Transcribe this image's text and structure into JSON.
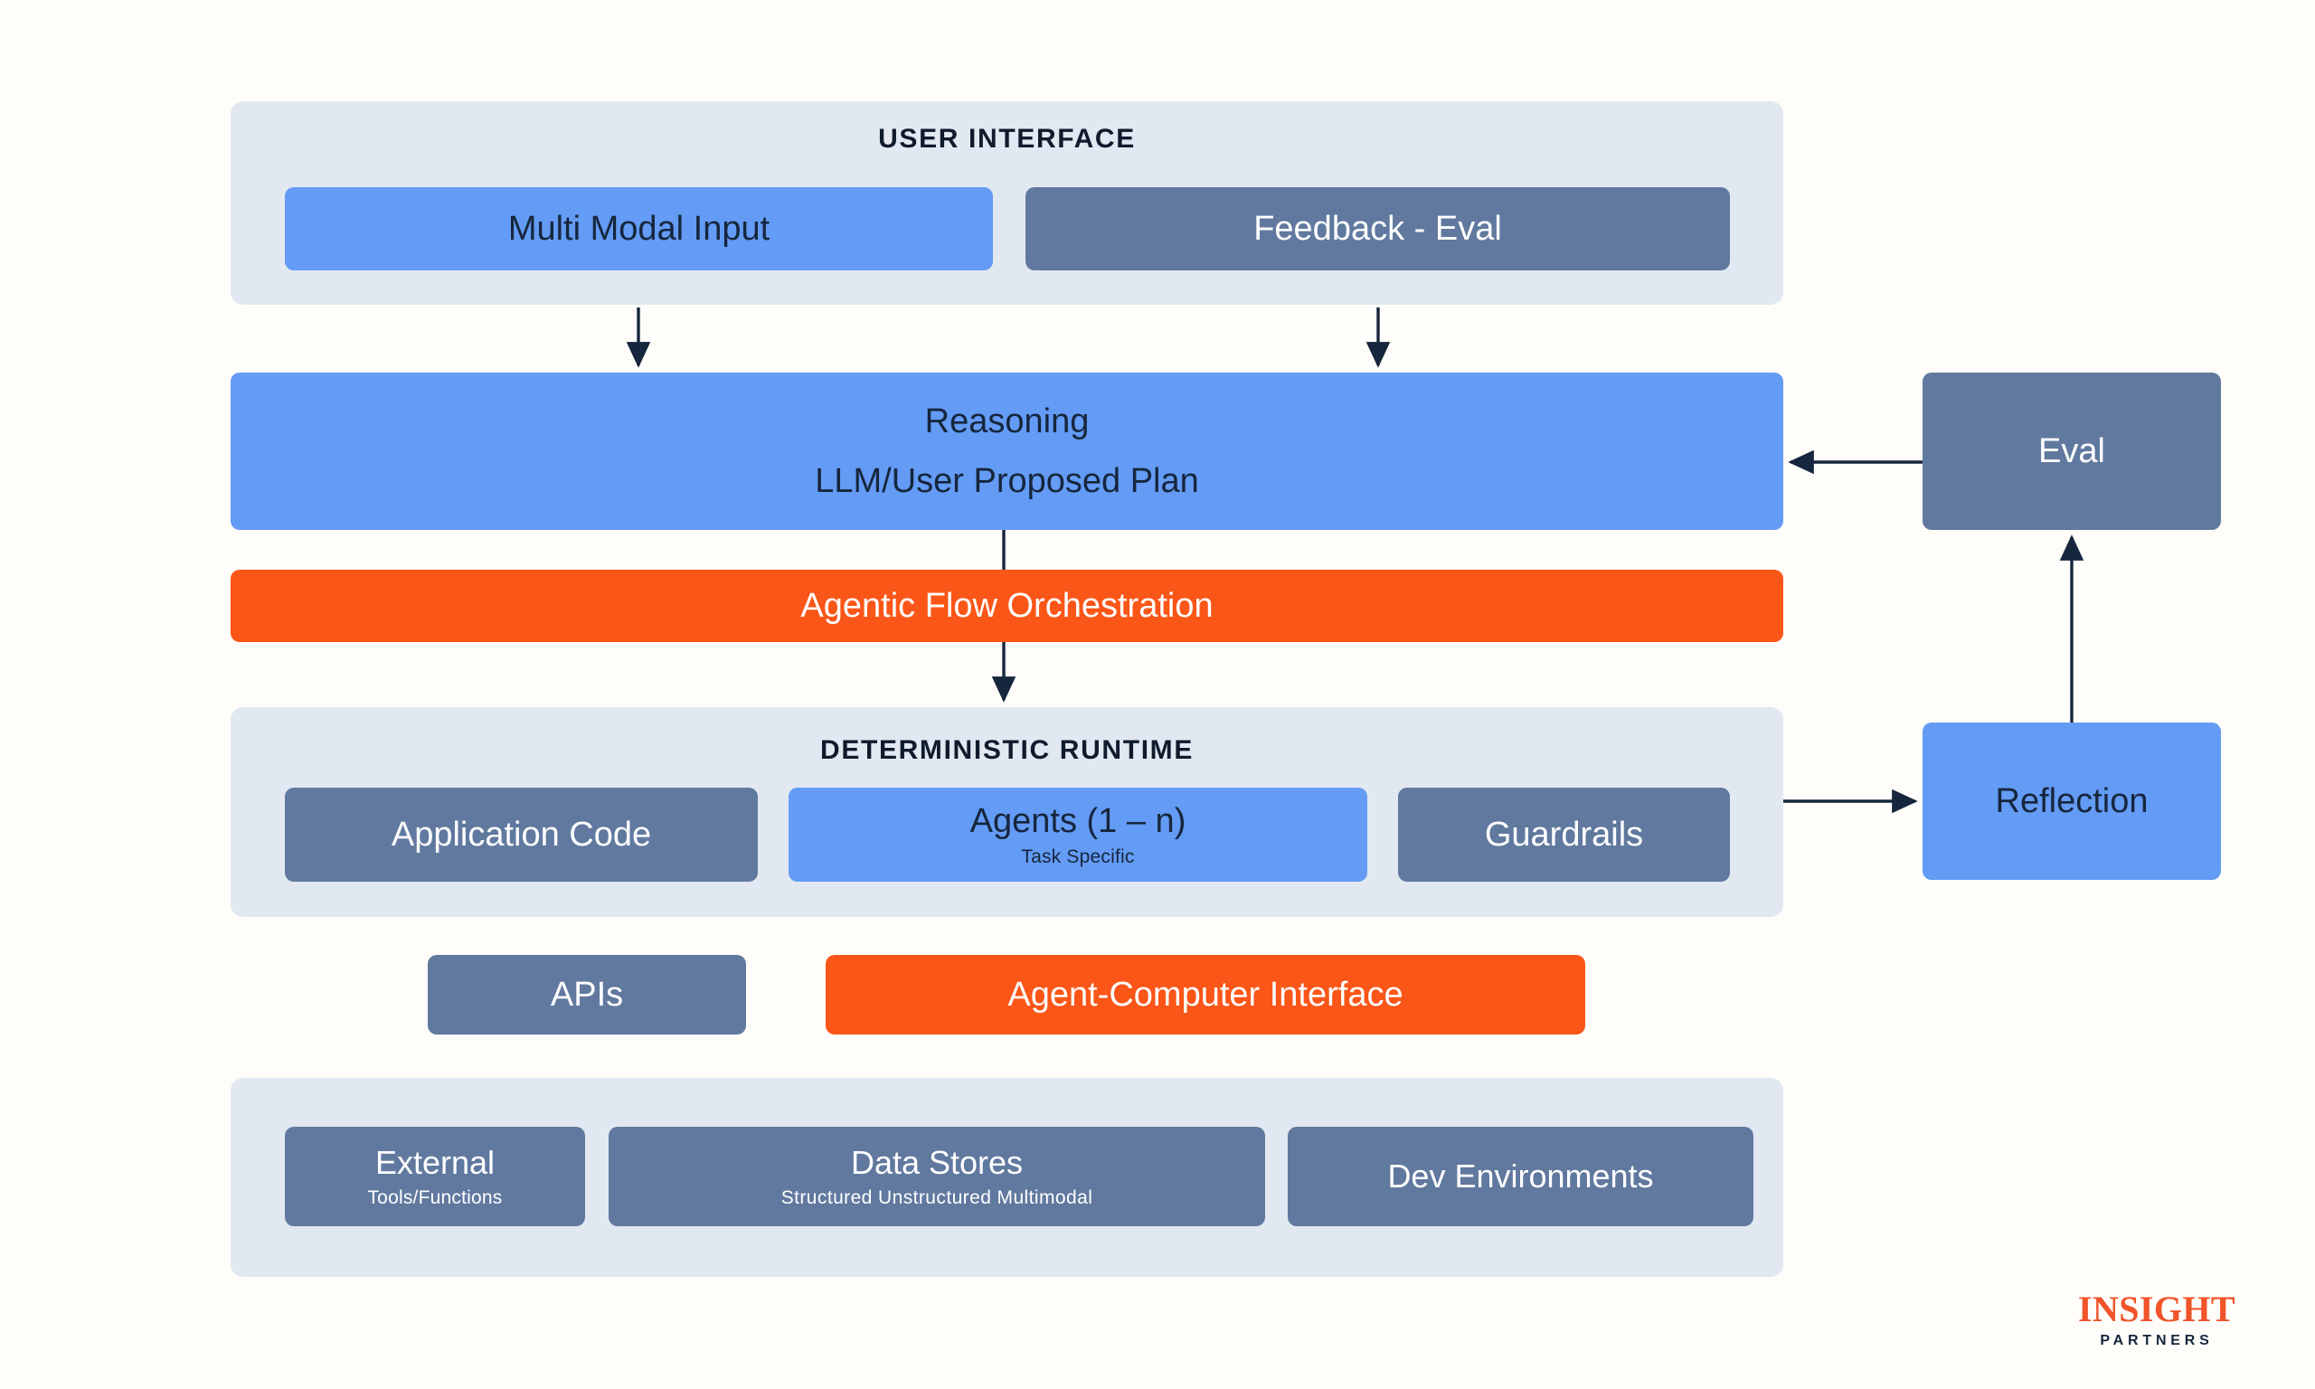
{
  "colors": {
    "page_background": "#FEFDFA",
    "panel": "#E2E8F1",
    "blue": "#639BF5",
    "slate": "#61799F",
    "orange": "#FA5618",
    "connector": "#16263C",
    "logo_orange": "#F0542A",
    "logo_navy": "#16263C"
  },
  "user_interface": {
    "title": "USER INTERFACE",
    "nodes": [
      {
        "label": "Multi Modal Input",
        "color": "blue"
      },
      {
        "label": "Feedback - Eval",
        "color": "slate"
      }
    ]
  },
  "reasoning": {
    "line1": "Reasoning",
    "line2": "LLM/User Proposed Plan",
    "color": "blue"
  },
  "orchestration": {
    "label": "Agentic Flow Orchestration",
    "color": "orange"
  },
  "deterministic_runtime": {
    "title": "DETERMINISTIC RUNTIME",
    "nodes": [
      {
        "label": "Application Code",
        "sublabel": "",
        "color": "slate"
      },
      {
        "label": "Agents (1 – n)",
        "sublabel": "Task Specific",
        "color": "blue"
      },
      {
        "label": "Guardrails",
        "sublabel": "",
        "color": "slate"
      }
    ]
  },
  "interface_layer": {
    "nodes": [
      {
        "label": "APIs",
        "color": "slate"
      },
      {
        "label": "Agent-Computer Interface",
        "color": "orange"
      }
    ]
  },
  "resources": {
    "nodes": [
      {
        "label": "External",
        "sublabel": "Tools/Functions",
        "color": "slate"
      },
      {
        "label": "Data Stores",
        "sublabel": "Structured   Unstructured   Multimodal",
        "color": "slate"
      },
      {
        "label": "Dev Environments",
        "sublabel": "",
        "color": "slate"
      }
    ]
  },
  "feedback_loop": {
    "eval": {
      "label": "Eval",
      "color": "slate"
    },
    "reflection": {
      "label": "Reflection",
      "color": "blue"
    }
  },
  "logo": {
    "mark": "INSIGHT",
    "sub": "PARTNERS"
  }
}
